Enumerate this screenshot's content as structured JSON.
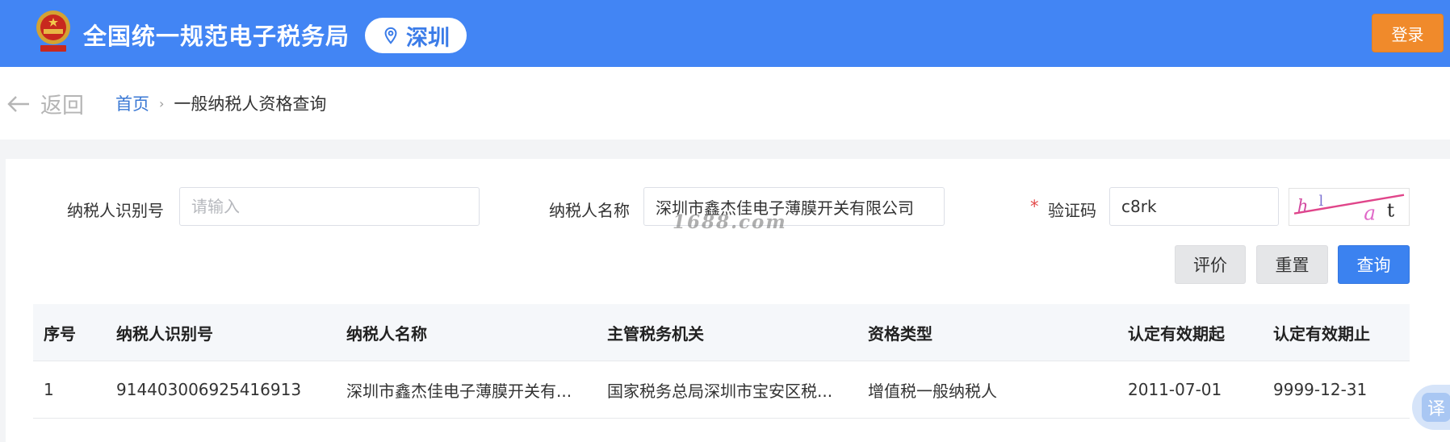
{
  "header": {
    "site_title": "全国统一规范电子税务局",
    "region": "深圳",
    "login_label": "登录"
  },
  "nav": {
    "back_label": "返回",
    "breadcrumb": {
      "home": "首页",
      "separator": "›",
      "current": "一般纳税人资格查询"
    }
  },
  "form": {
    "tax_id": {
      "label": "纳税人识别号",
      "value": "",
      "placeholder": "请输入"
    },
    "name": {
      "label": "纳税人名称",
      "value": "深圳市鑫杰佳电子薄膜开关有限公司"
    },
    "captcha": {
      "required_mark": "*",
      "label": "验证码",
      "value": "c8rk"
    },
    "watermark": "1688.com",
    "buttons": {
      "evaluate": "评价",
      "reset": "重置",
      "query": "查询"
    }
  },
  "table": {
    "columns": [
      "序号",
      "纳税人识别号",
      "纳税人名称",
      "主管税务机关",
      "资格类型",
      "认定有效期起",
      "认定有效期止"
    ],
    "rows": [
      [
        "1",
        "914403006925416913",
        "深圳市鑫杰佳电子薄膜开关有...",
        "国家税务总局深圳市宝安区税...",
        "增值税一般纳税人",
        "2011-07-01",
        "9999-12-31"
      ]
    ]
  },
  "translate_fab": {
    "glyph": "译"
  },
  "colors": {
    "header": "#4285f4",
    "login": "#f08a2b",
    "primary": "#3b82f0",
    "link": "#3a78d4",
    "required": "#e34b4b"
  },
  "icons": {
    "emblem": "national-emblem-icon",
    "pin": "location-pin-icon",
    "back": "arrow-left-icon",
    "captcha": "captcha-image"
  }
}
